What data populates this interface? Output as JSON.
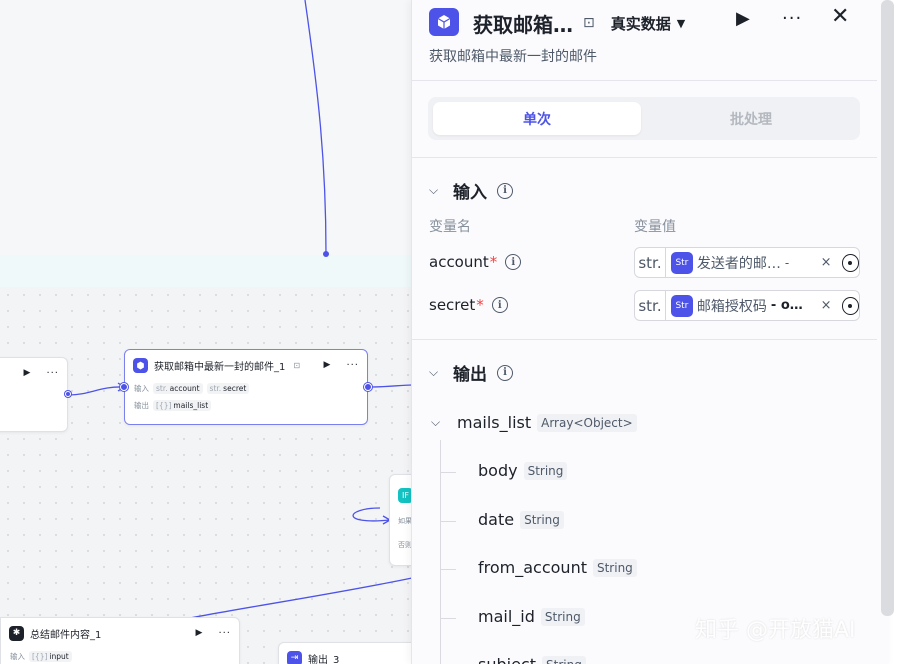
{
  "canvas": {
    "node_mail": {
      "title": "获取邮箱中最新一封的邮件_1",
      "input_label": "输入",
      "output_label": "输出",
      "inputs": [
        {
          "type": "str.",
          "name": "account"
        },
        {
          "type": "str.",
          "name": "secret"
        }
      ],
      "outputs": [
        {
          "type": "[{}]",
          "name": "mails_list"
        }
      ]
    },
    "node_if": {
      "badge": "IF",
      "line1": "如果",
      "line2": "否则"
    },
    "node_summary": {
      "title": "总结邮件内容_1",
      "input_label": "输入",
      "input_tag_type": "[{}]",
      "input_tag_name": "input"
    },
    "node_output": {
      "title": "输出_3"
    }
  },
  "panel": {
    "title": "获取邮箱…",
    "mode": "真实数据",
    "description": "获取邮箱中最新一封的邮件",
    "tabs": [
      "单次",
      "批处理"
    ],
    "input_section": "输入",
    "col_name": "变量名",
    "col_value": "变量值",
    "inputs": [
      {
        "name": "account",
        "required": "*",
        "type": "str.",
        "ref_text": "发送者的邮…",
        "ref_sub": "-",
        "remove": "×"
      },
      {
        "name": "secret",
        "required": "*",
        "type": "str.",
        "ref_text": "邮箱授权码",
        "ref_sub": "- o…",
        "remove": "×"
      }
    ],
    "output_section": "输出",
    "outputs": {
      "root": {
        "name": "mails_list",
        "type": "Array<Object>"
      },
      "children": [
        {
          "name": "body",
          "type": "String"
        },
        {
          "name": "date",
          "type": "String"
        },
        {
          "name": "from_account",
          "type": "String"
        },
        {
          "name": "mail_id",
          "type": "String"
        },
        {
          "name": "subject",
          "type": "String"
        }
      ]
    }
  },
  "watermark": "知乎 @开放猫AI",
  "colors": {
    "accent": "#4d53e8",
    "required": "#f53f3f",
    "if_badge": "#13c2c2",
    "summary_icon": "#1d2129",
    "output_icon": "#4d53e8"
  },
  "icons": {
    "node_icon": "cube-icon",
    "ref_icon": "plugin-str-icon",
    "run": "play-icon",
    "more": "more-dots-icon",
    "close": "close-icon",
    "info": "info-icon",
    "target": "target-icon"
  }
}
